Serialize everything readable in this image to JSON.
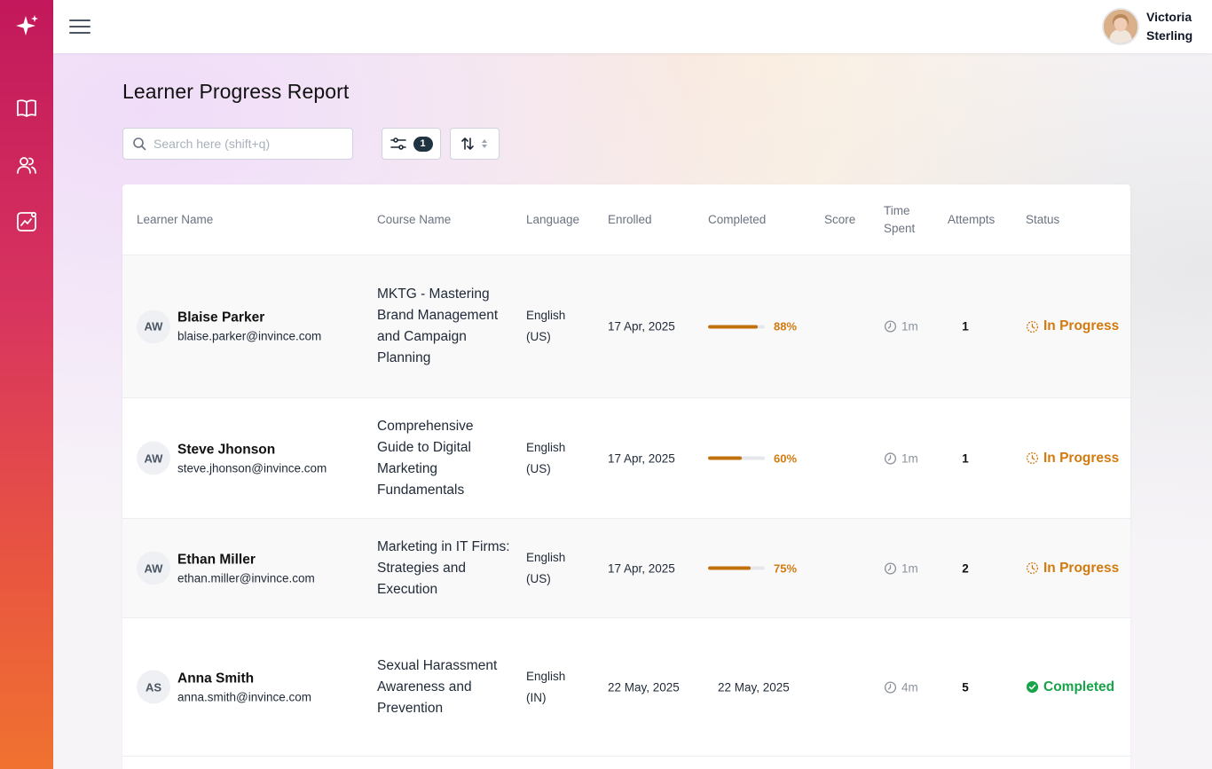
{
  "sidebar": {
    "items": [
      {
        "icon": "book-icon"
      },
      {
        "icon": "users-icon"
      },
      {
        "icon": "analytics-icon"
      }
    ]
  },
  "user": {
    "name": "Victoria Sterling"
  },
  "page": {
    "title": "Learner Progress Report"
  },
  "toolbar": {
    "search_placeholder": "Search here (shift+q)",
    "filter_count": "1"
  },
  "table": {
    "headers": {
      "learner": "Learner Name",
      "course": "Course Name",
      "language": "Language",
      "enrolled": "Enrolled",
      "completed": "Completed",
      "score": "Score",
      "time": "Time Spent",
      "attempts": "Attempts",
      "status": "Status"
    },
    "rows": [
      {
        "initials": "AW",
        "name": "Blaise Parker",
        "email": "blaise.parker@invince.com",
        "course": "MKTG - Mastering Brand Management and Campaign Planning",
        "language": "English (US)",
        "enrolled": "17 Apr, 2025",
        "progress": 88,
        "progress_label": "88%",
        "completed_date": "",
        "score": "",
        "time": "1m",
        "attempts": "1",
        "status": "In Progress",
        "status_type": "inprogress"
      },
      {
        "initials": "AW",
        "name": "Steve Jhonson",
        "email": "steve.jhonson@invince.com",
        "course": "Comprehensive Guide to Digital Marketing Fundamentals",
        "language": "English (US)",
        "enrolled": "17 Apr, 2025",
        "progress": 60,
        "progress_label": "60%",
        "completed_date": "",
        "score": "",
        "time": "1m",
        "attempts": "1",
        "status": "In Progress",
        "status_type": "inprogress"
      },
      {
        "initials": "AW",
        "name": "Ethan Miller",
        "email": "ethan.miller@invince.com",
        "course": "Marketing in IT Firms: Strategies and Execution",
        "language": "English (US)",
        "enrolled": "17 Apr, 2025",
        "progress": 75,
        "progress_label": "75%",
        "completed_date": "",
        "score": "",
        "time": "1m",
        "attempts": "2",
        "status": "In Progress",
        "status_type": "inprogress"
      },
      {
        "initials": "AS",
        "name": "Anna Smith",
        "email": "anna.smith@invince.com",
        "course": "Sexual Harassment Awareness and Prevention",
        "language": "English (IN)",
        "enrolled": "22 May, 2025",
        "progress": null,
        "progress_label": "",
        "completed_date": "22 May, 2025",
        "score": "",
        "time": "4m",
        "attempts": "5",
        "status": "Completed",
        "status_type": "completed"
      }
    ]
  },
  "colors": {
    "sidebar_top": "#c2185b",
    "sidebar_bottom": "#f07230",
    "in_progress": "#d27a0e",
    "completed": "#17a34a",
    "progress_bar": "#c2700c"
  }
}
